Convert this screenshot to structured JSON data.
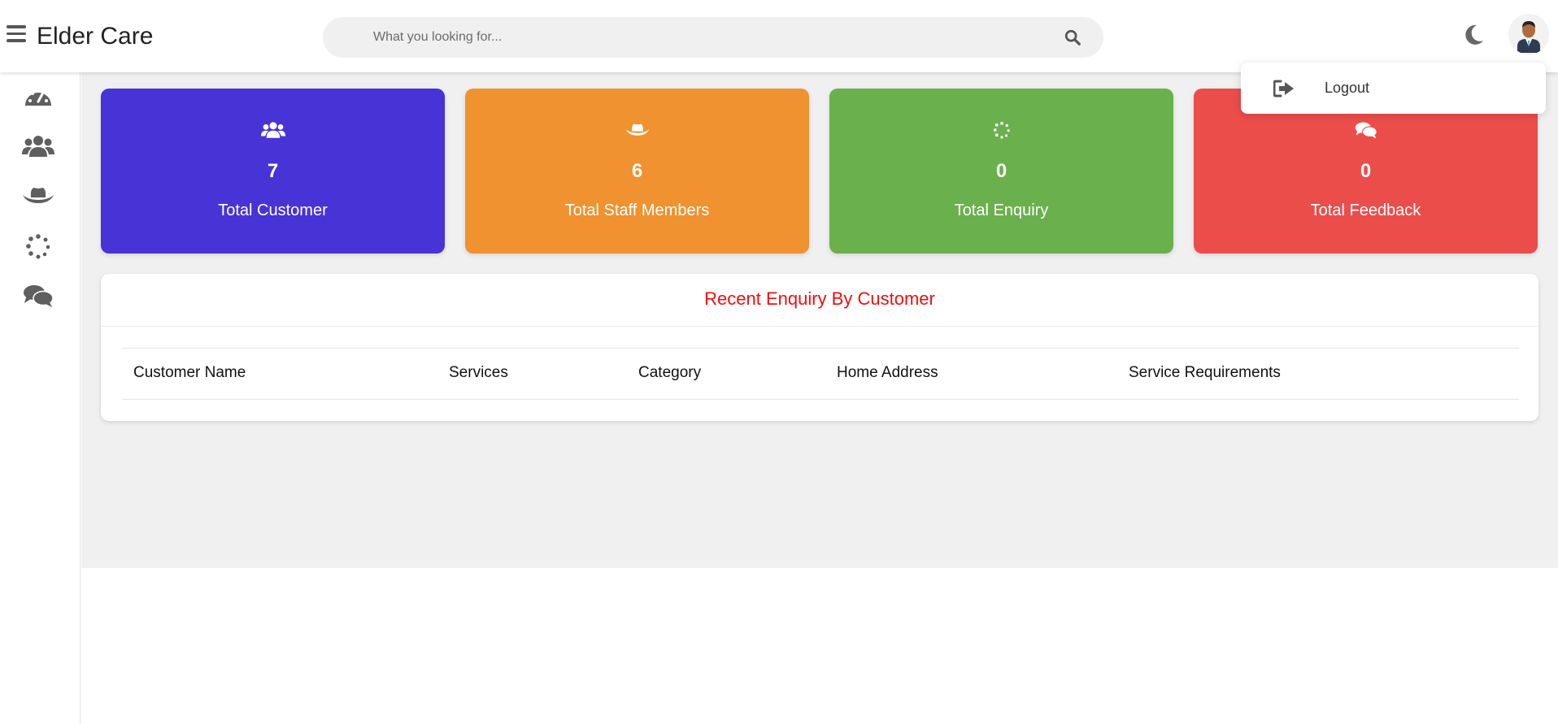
{
  "header": {
    "title": "Elder Care",
    "search_placeholder": "What you looking for...",
    "search_value": ""
  },
  "sidebar": {
    "items": [
      {
        "name": "dashboard",
        "icon": "tachometer-icon"
      },
      {
        "name": "customers",
        "icon": "users-icon"
      },
      {
        "name": "staff",
        "icon": "cowboy-hat-icon"
      },
      {
        "name": "enquiry",
        "icon": "spinner-icon"
      },
      {
        "name": "feedback",
        "icon": "comments-icon"
      }
    ]
  },
  "cards": [
    {
      "icon": "users-icon",
      "count": "7",
      "label": "Total Customer",
      "color": "#4733d6"
    },
    {
      "icon": "cowboy-hat-icon",
      "count": "6",
      "label": "Total Staff Members",
      "color": "#ef922f"
    },
    {
      "icon": "spinner-icon",
      "count": "0",
      "label": "Total Enquiry",
      "color": "#6ab04c"
    },
    {
      "icon": "comments-icon",
      "count": "0",
      "label": "Total Feedback",
      "color": "#eb4d4b"
    }
  ],
  "enquiry_panel": {
    "title": "Recent Enquiry By Customer",
    "title_color": "#f20d0d",
    "columns": [
      "Customer Name",
      "Services",
      "Category",
      "Home Address",
      "Service Requirements"
    ],
    "rows": []
  },
  "dropdown": {
    "items": [
      {
        "label": "Logout",
        "icon": "sign-out-icon"
      }
    ]
  }
}
